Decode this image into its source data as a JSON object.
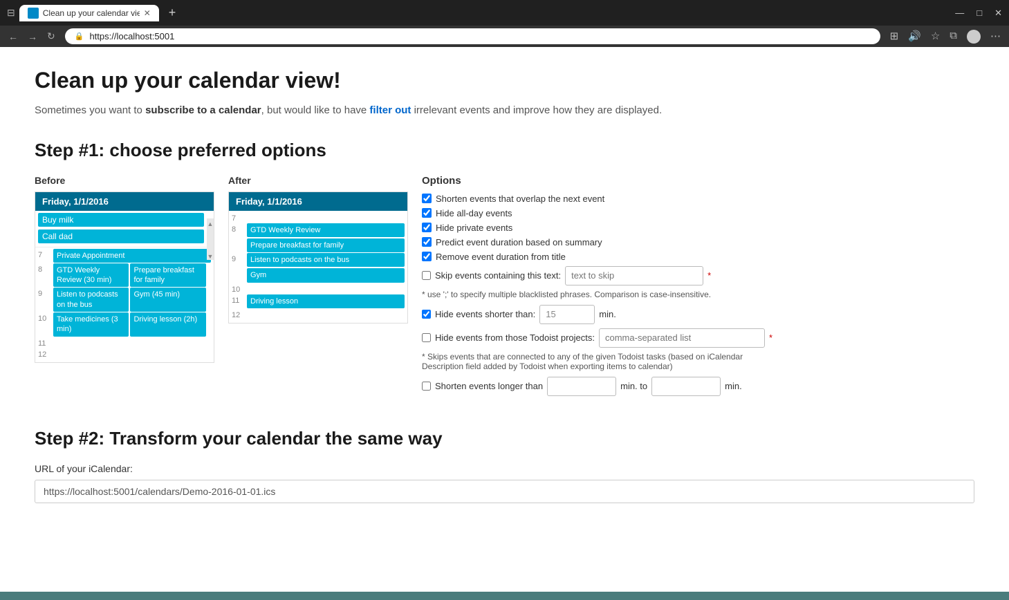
{
  "browser": {
    "tab_title": "Clean up your calendar view! - C",
    "url": "https://localhost:5001",
    "new_tab_icon": "+",
    "window_controls": [
      "—",
      "□",
      "✕"
    ]
  },
  "page": {
    "title": "Clean up your calendar view!",
    "subtitle_parts": [
      "Sometimes you want to ",
      "subscribe to a calendar",
      ", but would like to have ",
      "filter out",
      " irrelevant events and improve how they are displayed."
    ],
    "step1_title": "Step #1: choose preferred options",
    "before_label": "Before",
    "after_label": "After",
    "options_label": "Options",
    "step2_title": "Step #2: Transform your calendar the same way",
    "url_label": "URL of your iCalendar:",
    "url_value": "https://localhost:5001/calendars/Demo-2016-01-01.ics"
  },
  "before_calendar": {
    "header": "Friday, 1/1/2016",
    "all_day_events": [
      {
        "label": "Buy milk"
      },
      {
        "label": "Call dad"
      }
    ],
    "time_slots": [
      {
        "time": "7",
        "events": [
          {
            "label": "Private Appointment",
            "wide": true,
            "col": 0
          }
        ]
      },
      {
        "time": "8",
        "events": [
          {
            "label": "GTD Weekly Review (30 min)",
            "wide": false,
            "col": 0
          },
          {
            "label": "Prepare breakfast for family",
            "wide": false,
            "col": 1
          }
        ]
      },
      {
        "time": "9",
        "events": [
          {
            "label": "Listen to podcasts on the bus",
            "wide": false,
            "col": 0
          },
          {
            "label": "Gym (45 min)",
            "wide": false,
            "col": 1
          }
        ]
      },
      {
        "time": "10",
        "events": [
          {
            "label": "Take medicines (3 min)",
            "wide": false,
            "col": 0
          },
          {
            "label": "Driving lesson (2h)",
            "wide": false,
            "col": 1
          }
        ]
      },
      {
        "time": "11",
        "events": []
      },
      {
        "time": "12",
        "events": []
      }
    ]
  },
  "after_calendar": {
    "header": "Friday, 1/1/2016",
    "time_slots": [
      {
        "time": "7",
        "events": []
      },
      {
        "time": "8",
        "events": [
          {
            "label": "GTD Weekly Review",
            "wide": true
          },
          {
            "label": "Prepare breakfast for family",
            "wide": true
          }
        ]
      },
      {
        "time": "9",
        "events": [
          {
            "label": "Listen to podcasts on the bus",
            "wide": true
          },
          {
            "label": "Gym",
            "wide": true
          }
        ]
      },
      {
        "time": "10",
        "events": []
      },
      {
        "time": "11",
        "events": [
          {
            "label": "Driving lesson",
            "wide": true
          }
        ]
      },
      {
        "time": "12",
        "events": []
      }
    ]
  },
  "options": {
    "checkboxes": [
      {
        "id": "opt1",
        "label": "Shorten events that overlap the next event",
        "checked": true
      },
      {
        "id": "opt2",
        "label": "Hide all-day events",
        "checked": true
      },
      {
        "id": "opt3",
        "label": "Hide private events",
        "checked": true
      },
      {
        "id": "opt4",
        "label": "Predict event duration based on summary",
        "checked": true
      },
      {
        "id": "opt5",
        "label": "Remove event duration from title",
        "checked": true
      }
    ],
    "skip_checkbox_label": "Skip events containing this text:",
    "skip_placeholder": "text to skip",
    "skip_hint": "* use ';' to specify multiple blacklisted phrases. Comparison is case-insensitive.",
    "hide_shorter_label": "Hide events shorter than:",
    "hide_shorter_value": "15",
    "hide_shorter_unit": "min.",
    "hide_shorter_checked": true,
    "todoist_label": "Hide events from those Todoist projects:",
    "todoist_placeholder": "comma-separated list",
    "todoist_hint": "* Skips events that are connected to any of the given Todoist tasks (based on iCalendar Description field added by Todoist when exporting items to calendar)",
    "shorten_longer_label": "Shorten events longer than",
    "shorten_longer_unit1": "min. to",
    "shorten_longer_unit2": "min."
  }
}
